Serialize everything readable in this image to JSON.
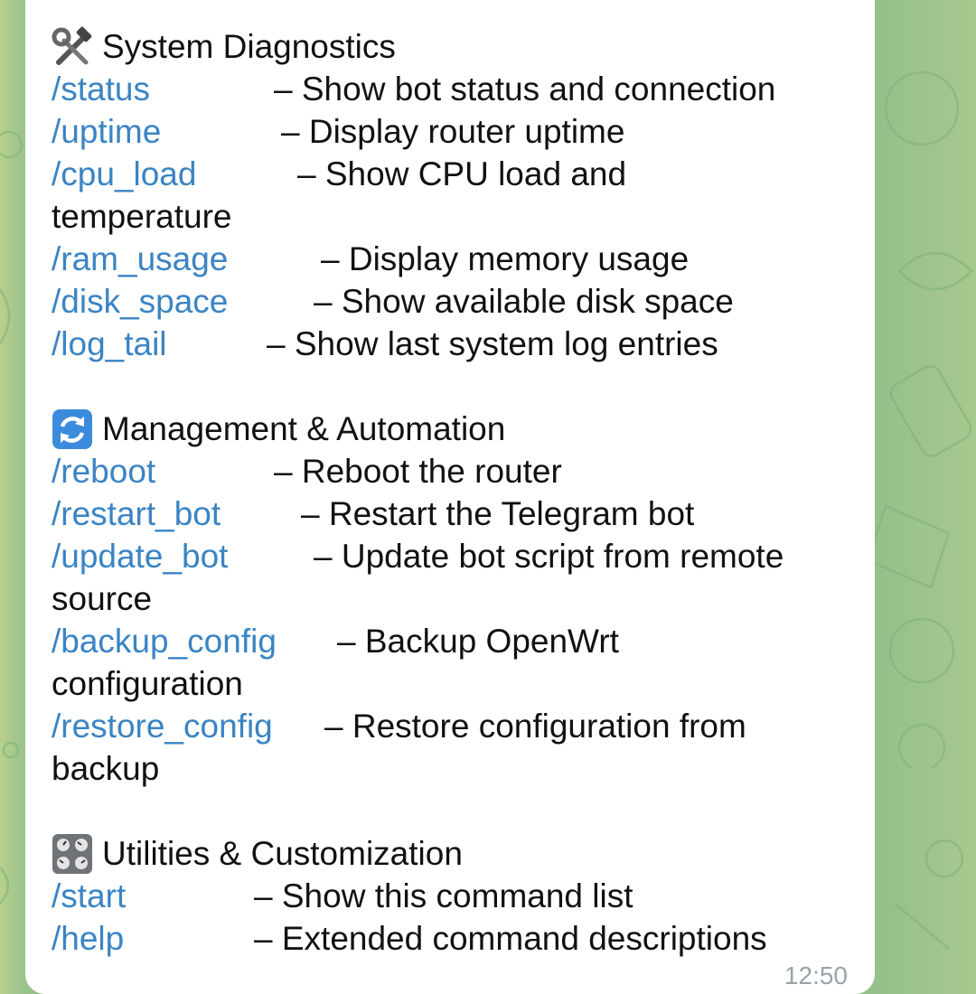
{
  "sections": [
    {
      "title": "System Diagnostics",
      "icon": "tools-icon",
      "commands": [
        {
          "cmd": "/status",
          "desc": "– Show bot status and connection"
        },
        {
          "cmd": "/uptime",
          "desc": "– Display router uptime"
        },
        {
          "cmd": "/cpu_load",
          "desc": "– Show CPU load and",
          "cont": "temperature"
        },
        {
          "cmd": "/ram_usage",
          "desc": "– Display memory usage"
        },
        {
          "cmd": "/disk_space",
          "desc": "– Show available disk space"
        },
        {
          "cmd": "/log_tail",
          "desc": "– Show last system log entries"
        }
      ]
    },
    {
      "title": "Management & Automation",
      "icon": "refresh-icon",
      "commands": [
        {
          "cmd": "/reboot",
          "desc": "– Reboot the router"
        },
        {
          "cmd": "/restart_bot",
          "desc": "– Restart the Telegram bot"
        },
        {
          "cmd": "/update_bot",
          "desc": "– Update bot script from remote",
          "cont": "source"
        },
        {
          "cmd": "/backup_config",
          "desc": "– Backup OpenWrt",
          "cont": "configuration"
        },
        {
          "cmd": "/restore_config",
          "desc": "– Restore configuration from",
          "cont": "backup"
        }
      ]
    },
    {
      "title": "Utilities & Customization",
      "icon": "control-knobs-icon",
      "commands": [
        {
          "cmd": "/start",
          "desc": "– Show this command list"
        },
        {
          "cmd": "/help",
          "desc": "– Extended command descriptions"
        }
      ]
    }
  ],
  "message": {
    "time": "12:50"
  },
  "colors": {
    "link": "#3a84c4",
    "text": "#111111",
    "bubble": "#ffffff",
    "time": "#9aa3a8"
  }
}
